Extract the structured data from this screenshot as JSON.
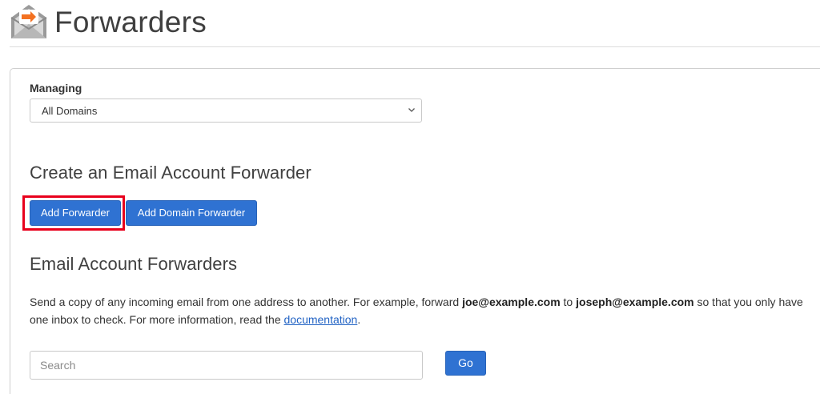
{
  "header": {
    "title": "Forwarders",
    "icon": "envelope-forward-icon",
    "icon_colors": {
      "envelope": "#8a8a8a",
      "arrow_bg": "#f37121"
    }
  },
  "managing": {
    "label": "Managing",
    "selected": "All Domains"
  },
  "create_section": {
    "title": "Create an Email Account Forwarder",
    "add_forwarder_label": "Add Forwarder",
    "add_domain_forwarder_label": "Add Domain Forwarder",
    "highlight_color": "#e8001c"
  },
  "forwarders_section": {
    "title": "Email Account Forwarders",
    "description": {
      "part1": "Send a copy of any incoming email from one address to another. For example, forward ",
      "example_from": "joe@example.com",
      "part2": " to ",
      "example_to": "joseph@example.com",
      "part3": " so that you only have one inbox to check. For more information, read the ",
      "link_text": "documentation",
      "part4": "."
    },
    "search_placeholder": "Search",
    "go_label": "Go"
  },
  "colors": {
    "button_blue": "#2f72d2",
    "link_blue": "#2263c4"
  }
}
